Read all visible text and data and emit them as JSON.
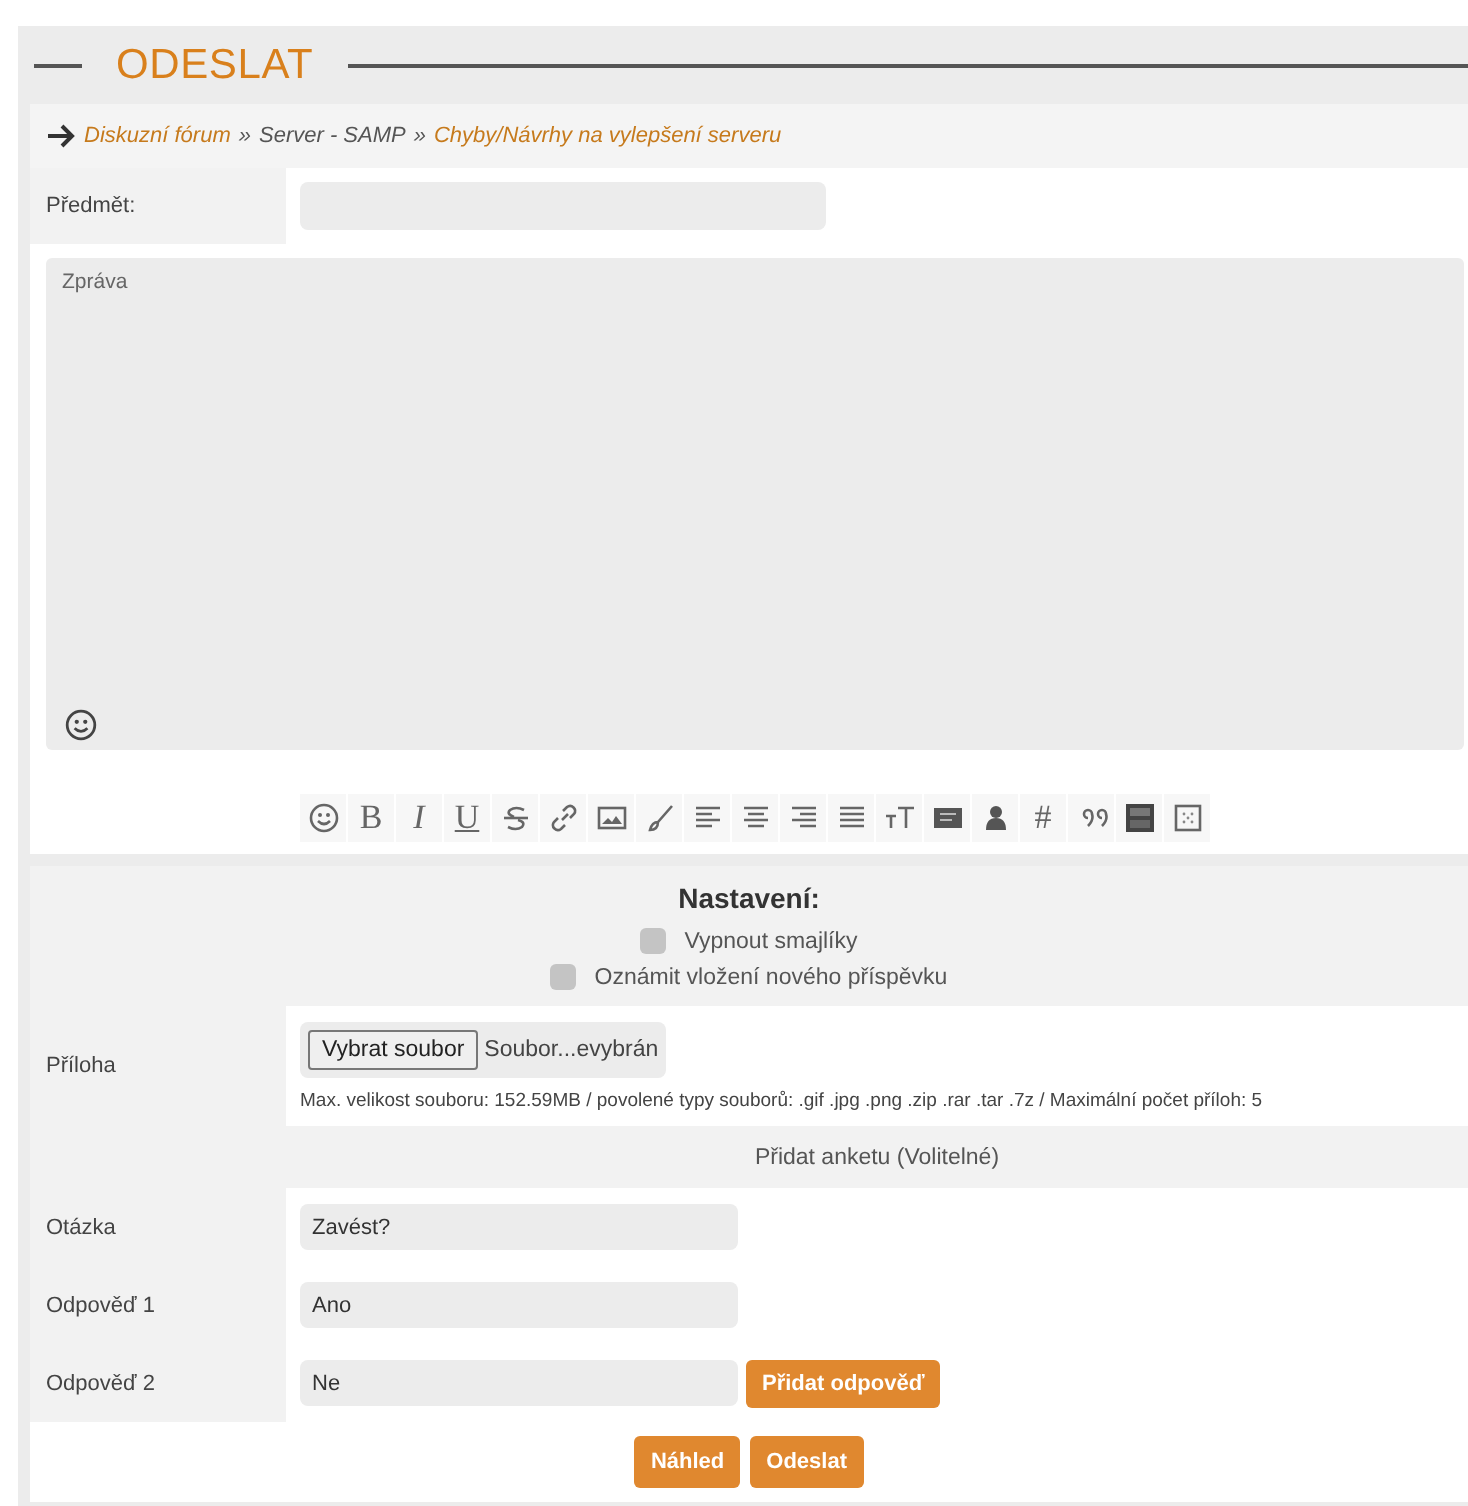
{
  "title": "ODESLAT",
  "breadcrumb": [
    {
      "text": "Diskuzní fórum",
      "kind": "link"
    },
    {
      "text": "»",
      "kind": "sep"
    },
    {
      "text": "Server - SAMP",
      "kind": "plain"
    },
    {
      "text": "»",
      "kind": "sep"
    },
    {
      "text": "Chyby/Návrhy na vylepšení serveru",
      "kind": "link"
    }
  ],
  "subject": {
    "label": "Předmět:"
  },
  "message": {
    "placeholder": "Zpráva"
  },
  "toolbar": [
    {
      "kind": "emoji"
    },
    {
      "kind": "glyph",
      "text": "B"
    },
    {
      "kind": "glyph",
      "text": "I"
    },
    {
      "kind": "glyph",
      "text": "U"
    },
    {
      "kind": "strike"
    },
    {
      "kind": "link"
    },
    {
      "kind": "image"
    },
    {
      "kind": "brush"
    },
    {
      "kind": "align-left"
    },
    {
      "kind": "align-center"
    },
    {
      "kind": "align-right"
    },
    {
      "kind": "justify"
    },
    {
      "kind": "font-size"
    },
    {
      "kind": "code"
    },
    {
      "kind": "user"
    },
    {
      "kind": "glyph",
      "text": "#"
    },
    {
      "kind": "quote"
    },
    {
      "kind": "video"
    },
    {
      "kind": "grid"
    }
  ],
  "settings": {
    "heading": "Nastavení:",
    "options": [
      {
        "label": "Vypnout smajlíky",
        "checked": false
      },
      {
        "label": "Oznámit vložení nového příspěvku",
        "checked": false
      }
    ]
  },
  "attachment": {
    "label": "Příloha",
    "button": "Vybrat soubor",
    "status": "Soubor...evybrán",
    "help": "Max. velikost souboru: 152.59MB / povolené typy souborů: .gif .jpg .png .zip .rar .tar .7z / Maximální počet příloh: 5"
  },
  "poll": {
    "heading": "Přidat anketu (Volitelné)",
    "rows": [
      {
        "label": "Otázka",
        "value": "Zavést?"
      },
      {
        "label": "Odpověď 1",
        "value": "Ano"
      },
      {
        "label": "Odpověď 2",
        "value": "Ne",
        "button": "Přidat odpověď"
      }
    ]
  },
  "actions": [
    "Náhled",
    "Odeslat"
  ]
}
